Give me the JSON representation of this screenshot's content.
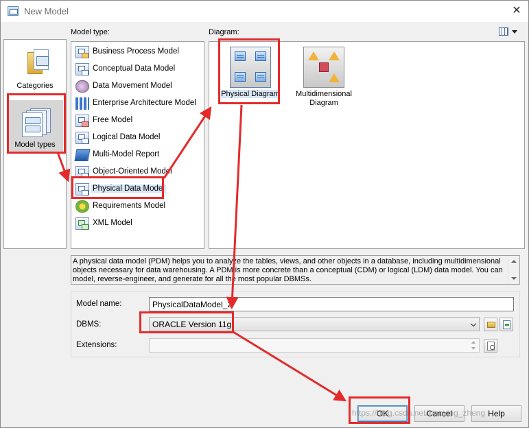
{
  "window": {
    "title": "New Model"
  },
  "labels": {
    "model_type": "Model type:",
    "diagram": "Diagram:"
  },
  "categories": [
    {
      "label": "Categories",
      "icon": "folder-icon",
      "selected": false
    },
    {
      "label": "Model types",
      "icon": "model-types-icon",
      "selected": true
    }
  ],
  "model_types": [
    {
      "label": "Business Process Model",
      "icon": "business-process-model-icon"
    },
    {
      "label": "Conceptual Data Model",
      "icon": "conceptual-data-model-icon"
    },
    {
      "label": "Data Movement Model",
      "icon": "data-movement-model-icon"
    },
    {
      "label": "Enterprise Architecture Model",
      "icon": "enterprise-architecture-model-icon"
    },
    {
      "label": "Free Model",
      "icon": "free-model-icon"
    },
    {
      "label": "Logical Data Model",
      "icon": "logical-data-model-icon"
    },
    {
      "label": "Multi-Model Report",
      "icon": "multi-model-report-icon"
    },
    {
      "label": "Object-Oriented Model",
      "icon": "object-oriented-model-icon"
    },
    {
      "label": "Physical Data Model",
      "icon": "physical-data-model-icon",
      "selected": true
    },
    {
      "label": "Requirements Model",
      "icon": "requirements-model-icon"
    },
    {
      "label": "XML Model",
      "icon": "xml-model-icon"
    }
  ],
  "diagrams": [
    {
      "label": "Physical Diagram",
      "icon": "physical-diagram-icon",
      "selected": true
    },
    {
      "label": "Multidimensional Diagram",
      "icon": "multidimensional-diagram-icon",
      "selected": false
    }
  ],
  "description": "A physical data model (PDM) helps you to analyze the tables, views, and other objects in a database, including multidimensional objects necessary for data warehousing. A PDM is more concrete than a conceptual (CDM) or logical (LDM) data model. You can model, reverse-engineer, and generate for all the most popular DBMSs.",
  "form": {
    "model_name_label": "Model name:",
    "model_name_value": "PhysicalDataModel_2",
    "dbms_label": "DBMS:",
    "dbms_value": "ORACLE Version 11g",
    "extensions_label": "Extensions:",
    "extensions_value": ""
  },
  "buttons": {
    "ok": "OK",
    "cancel": "Cancel",
    "help": "Help"
  },
  "watermark": "https://blog.csdn.net/xianying_zheng",
  "colors": {
    "annotation": "#e32b2b",
    "selection": "#d8e6f5",
    "window_bg": "#f0f0f0"
  }
}
